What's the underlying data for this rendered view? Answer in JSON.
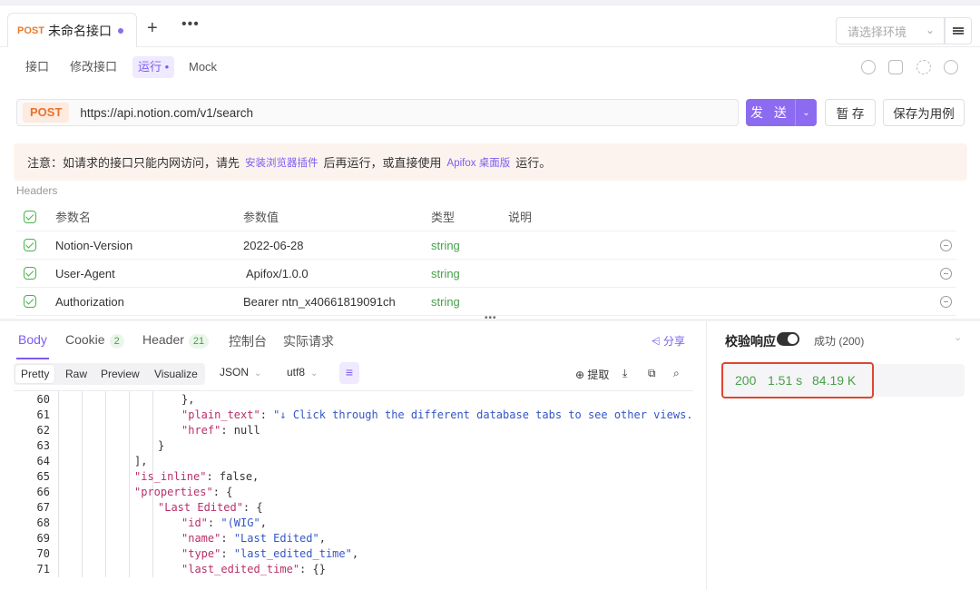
{
  "tab": {
    "method": "POST",
    "title": "未命名接口",
    "add": "+",
    "more": "•••"
  },
  "env": {
    "placeholder": "请选择环境"
  },
  "subtabs": [
    "接口",
    "修改接口",
    "运行 •",
    "Mock"
  ],
  "request": {
    "method": "POST",
    "url": "https://api.notion.com/v1/search",
    "send": "发 送",
    "save": "暂 存",
    "save_case": "保存为用例"
  },
  "notice": {
    "p1": "注意：如请求的接口只能内网访问，请先",
    "link1": "安装浏览器插件",
    "p2": "后再运行，或直接使用",
    "link2": "Apifox 桌面版",
    "p3": "运行。"
  },
  "params": {
    "section_label": "Headers",
    "columns": [
      "参数名",
      "参数值",
      "类型",
      "说明"
    ],
    "rows": [
      {
        "name": "Notion-Version",
        "value": "2022-06-28",
        "type": "string"
      },
      {
        "name": "User-Agent",
        "value": "Apifox/1.0.0",
        "type": "string"
      },
      {
        "name": "Authorization",
        "value": "Bearer ntn_x40661819091ch",
        "type": "string"
      }
    ]
  },
  "resp_tabs": {
    "body": "Body",
    "cookie": "Cookie",
    "cookie_count": "2",
    "header": "Header",
    "header_count": "21",
    "console": "控制台",
    "actual": "实际请求",
    "share": "分享"
  },
  "format": {
    "pretty": "Pretty",
    "raw": "Raw",
    "preview": "Preview",
    "visualize": "Visualize",
    "lang": "JSON",
    "encoding": "utf8",
    "extract": "提取"
  },
  "code": {
    "line_numbers": [
      "60",
      "61",
      "62",
      "63",
      "64",
      "65",
      "66",
      "67",
      "68",
      "69",
      "70",
      "71"
    ]
  },
  "response": {
    "validate": "校验响应",
    "status_text": "成功 (200)",
    "code": "200",
    "time": "1.51 s",
    "size": "84.19 K"
  }
}
